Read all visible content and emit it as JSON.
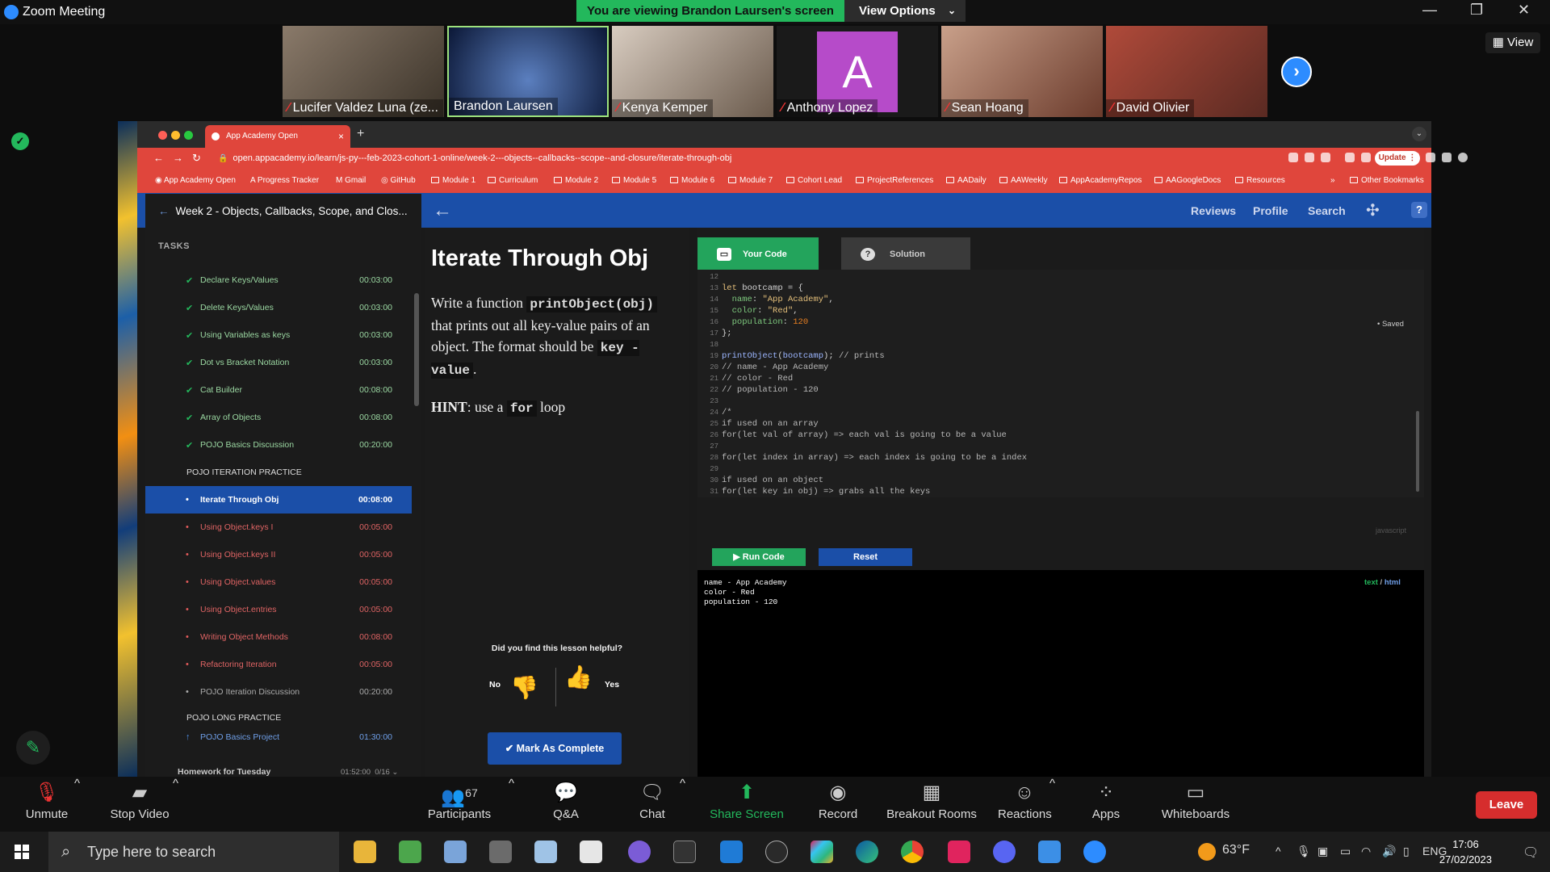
{
  "zoom": {
    "title": "Zoom Meeting",
    "viewing_banner": "You are viewing Brandon Laursen's screen",
    "view_options": "View Options",
    "view_button": "View",
    "participants": [
      {
        "name": "Lucifer Valdez Luna (ze...",
        "muted": true
      },
      {
        "name": "Brandon Laursen",
        "muted": false
      },
      {
        "name": "Kenya Kemper",
        "muted": true
      },
      {
        "name": "Anthony Lopez",
        "muted": true,
        "avatar_letter": "A"
      },
      {
        "name": "Sean Hoang",
        "muted": true
      },
      {
        "name": "David Olivier",
        "muted": true
      }
    ],
    "toolbar": {
      "unmute": "Unmute",
      "stop_video": "Stop Video",
      "participants": "Participants",
      "participants_count": "67",
      "qa": "Q&A",
      "chat": "Chat",
      "share_screen": "Share Screen",
      "record": "Record",
      "breakout_rooms": "Breakout Rooms",
      "reactions": "Reactions",
      "apps": "Apps",
      "whiteboards": "Whiteboards",
      "leave": "Leave"
    }
  },
  "browser": {
    "tab_title": "App Academy Open",
    "url": "open.appacademy.io/learn/js-py---feb-2023-cohort-1-online/week-2---objects--callbacks--scope--and-closure/iterate-through-obj",
    "update_label": "Update",
    "bookmarks": [
      "App Academy Open",
      "Progress Tracker",
      "Gmail",
      "GitHub",
      "Module 1",
      "Curriculum",
      "Module 2",
      "Module 5",
      "Module 6",
      "Module 7",
      "Cohort Lead",
      "ProjectReferences",
      "AADaily",
      "AAWeekly",
      "AppAcademyRepos",
      "AAGoogleDocs",
      "Resources"
    ],
    "other_bookmarks": "Other Bookmarks"
  },
  "app": {
    "header_links": {
      "reviews": "Reviews",
      "profile": "Profile",
      "search": "Search"
    },
    "week_title": "Week 2 - Objects, Callbacks, Scope, and Clos...",
    "tasks_heading": "TASKS",
    "tasks_top": [
      {
        "label": "Declare Keys/Values",
        "time": "00:03:00"
      },
      {
        "label": "Delete Keys/Values",
        "time": "00:03:00"
      },
      {
        "label": "Using Variables as keys",
        "time": "00:03:00"
      },
      {
        "label": "Dot vs Bracket Notation",
        "time": "00:03:00"
      },
      {
        "label": "Cat Builder",
        "time": "00:08:00"
      },
      {
        "label": "Array of Objects",
        "time": "00:08:00"
      },
      {
        "label": "POJO Basics Discussion",
        "time": "00:20:00"
      }
    ],
    "section_iteration": "POJO ITERATION PRACTICE",
    "tasks_iteration": [
      {
        "label": "Iterate Through Obj",
        "time": "00:08:00",
        "state": "active"
      },
      {
        "label": "Using Object.keys I",
        "time": "00:05:00",
        "state": "red"
      },
      {
        "label": "Using Object.keys II",
        "time": "00:05:00",
        "state": "red"
      },
      {
        "label": "Using Object.values",
        "time": "00:05:00",
        "state": "red"
      },
      {
        "label": "Using Object.entries",
        "time": "00:05:00",
        "state": "red"
      },
      {
        "label": "Writing Object Methods",
        "time": "00:08:00",
        "state": "red"
      },
      {
        "label": "Refactoring Iteration",
        "time": "00:05:00",
        "state": "red"
      },
      {
        "label": "POJO Iteration Discussion",
        "time": "00:20:00",
        "state": "gray"
      }
    ],
    "section_long": "POJO LONG PRACTICE",
    "tasks_long": [
      {
        "label": "POJO Basics Project",
        "time": "01:30:00",
        "state": "blue"
      }
    ],
    "homework": {
      "label": "Homework for Tuesday",
      "time": "01:52:00",
      "count": "0/16"
    },
    "lesson": {
      "title": "Iterate Through Obj",
      "p1_a": "Write a function",
      "p1_code": "printObject(obj)",
      "p1_b": "that prints out all key-value pairs of an object. The format should be",
      "p1_code2": "key - value",
      "p1_c": ".",
      "hint_label": "HINT",
      "hint_a": ": use a",
      "hint_code": "for",
      "hint_b": "loop",
      "helpful_q": "Did you find this lesson helpful?",
      "no": "No",
      "yes": "Yes",
      "mark_complete": "✔ Mark As Complete"
    },
    "editor": {
      "tab_your_code": "Your Code",
      "tab_solution": "Solution",
      "saved": "• Saved",
      "language": "javascript",
      "run": "▶ Run Code",
      "reset": "Reset",
      "output_mode_a": "text",
      "output_mode_sep": " / ",
      "output_mode_b": "html",
      "line_start": 12,
      "output": [
        "name - App Academy",
        "color - Red",
        "population - 120"
      ]
    }
  },
  "taskbar": {
    "search_placeholder": "Type here to search",
    "weather": "63°F",
    "language": "ENG",
    "time": "17:06",
    "date": "27/02/2023"
  },
  "colors": {
    "zoom_green": "#23b85c",
    "zoom_blue": "#2d8cff",
    "aa_red": "#e0463c",
    "aa_blue": "#1b4fa8",
    "leave_red": "#d62d2d"
  }
}
